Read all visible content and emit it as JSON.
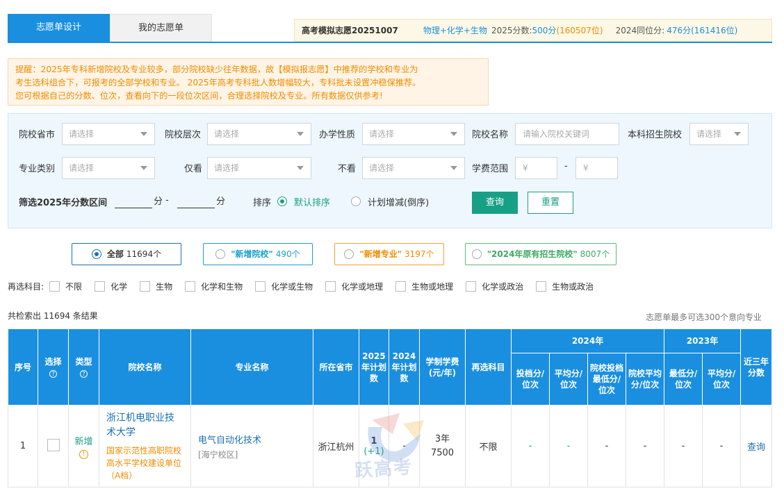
{
  "tabs": [
    {
      "label": "志愿单设计",
      "active": true
    },
    {
      "label": "我的志愿单",
      "active": false
    }
  ],
  "summary": {
    "title": "高考模拟志愿20251007",
    "subjects": "物理+化学+生物",
    "score_label": "2025分数:",
    "score": "500分",
    "rank": "(160507位)",
    "same_label": "2024同位分:",
    "same_score": "476分(161416位)"
  },
  "notice": {
    "line1": "提醒：2025年专科新增院校及专业较多，部分院校缺少往年数据，故【模拟报志愿】中推荐的学校和专业为",
    "line2": "考生选科组合下，可报考的全部学校和专业。 2025年高考专科批人数增幅较大，专科批未设置冲稳保推荐。",
    "line3": "您可根据自己的分数、位次，查看向下的一段位次区间，合理选择院校及专业。所有数据仅供参考!"
  },
  "filter": {
    "province_label": "院校省市",
    "level_label": "院校层次",
    "nature_label": "办学性质",
    "name_label": "院校名称",
    "bachelor_label": "本科招生院校",
    "category_label": "专业类别",
    "only_label": "仅看",
    "exclude_label": "不看",
    "fee_label": "学费范围",
    "select_placeholder": "请选择",
    "name_placeholder": "请输入院校关键词",
    "fee_placeholder": "¥",
    "fee_dash": "-",
    "score_range_label": "筛选2025年分数区间",
    "score_unit": "分",
    "score_dash": "-",
    "sort_label": "排序",
    "sort_default": "默认排序",
    "sort_plan": "计划增减(倒序)",
    "query_button": "查询",
    "reset_button": "重置"
  },
  "categories": [
    {
      "label": "全部",
      "count": "11694个",
      "active": true
    },
    {
      "label": "\"新增院校\"",
      "count": "490个",
      "active": false
    },
    {
      "label": "\"新增专业\"",
      "count": "3197个",
      "active": false
    },
    {
      "label": "\"2024年原有招生院校\"",
      "count": "8007个",
      "active": false
    }
  ],
  "subjects": {
    "label": "再选科目:",
    "options": [
      "不限",
      "化学",
      "生物",
      "化学和生物",
      "化学或生物",
      "化学或地理",
      "生物或地理",
      "化学或政治",
      "生物或政治"
    ]
  },
  "results": {
    "count_text": "共检索出 11694 条结果",
    "limit_text": "志愿单最多可选300个意向专业"
  },
  "table": {
    "headers": {
      "index": "序号",
      "select": "选择",
      "type": "类型",
      "school": "院校名称",
      "major": "专业名称",
      "location": "所在省市",
      "plan2025": "2025年计划数",
      "plan2024": "2024年计划数",
      "tuition": "学制学费(元/年)",
      "subjects": "再选科目",
      "y2024": "2024年",
      "y2023": "2023年",
      "three_year": "近三年分数",
      "min_rank": "投档分/位次",
      "avg_rank": "平均分/位次",
      "school_min": "院校投档最低分/位次",
      "school_avg": "院校平均分/位次",
      "min_2023": "最低分/位次",
      "avg_2023": "平均分/位次",
      "help": "?"
    },
    "rows": [
      {
        "index": "1",
        "type": "新增",
        "type_icon": "!",
        "school_name": "浙江机电职业技术大学",
        "school_tag": "国家示范性高职院校 高水平学校建设单位（A档）",
        "major_name": "电气自动化技术",
        "campus": "[海宁校区]",
        "location": "浙江杭州",
        "plan2025": "1",
        "plan_change": "(+1)",
        "plan2024": "-",
        "tuition": "3年7500",
        "subjects": "不限",
        "min_rank": "-",
        "avg_rank": "-",
        "school_min": "-",
        "school_avg": "-",
        "min_2023": "-",
        "avg_2023": "-",
        "action": "查询"
      }
    ]
  },
  "watermark": "跃高考",
  "colors": {
    "primary": "#1a8fe0",
    "green": "#17a085",
    "orange": "#f08c00"
  }
}
